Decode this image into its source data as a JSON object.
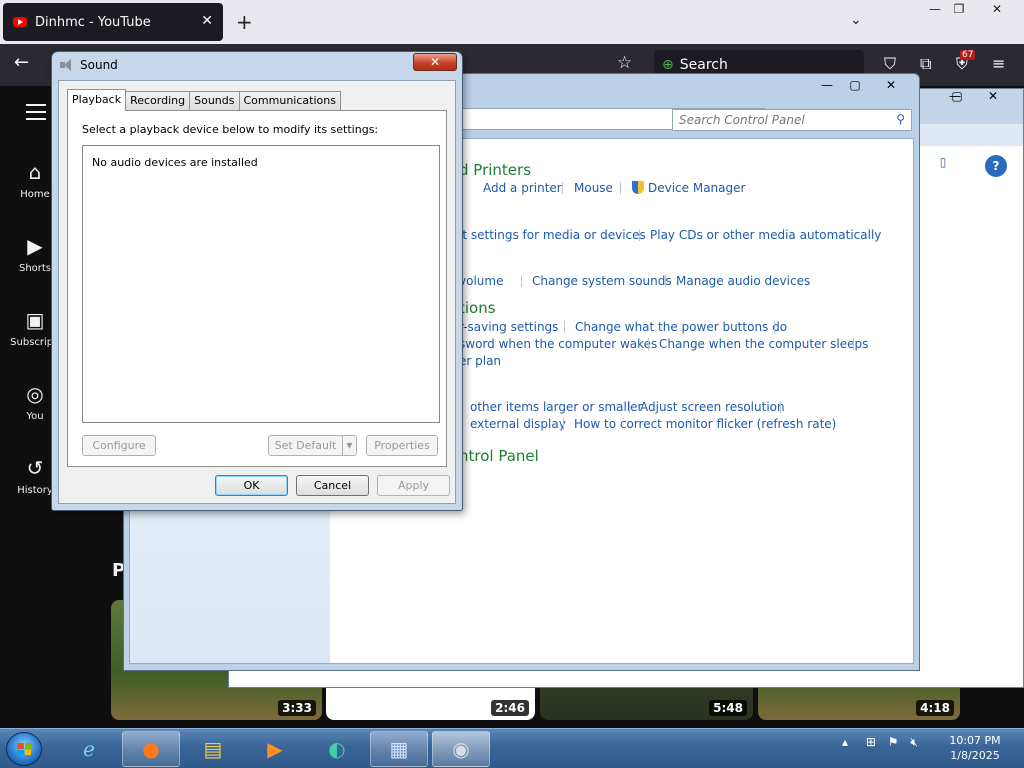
{
  "browser": {
    "tab_title": "Dinhmc - YouTube",
    "new_tab": "+",
    "search_placeholder": "Search",
    "badge": "67"
  },
  "youtube": {
    "nav": [
      {
        "icon": "home-icon",
        "label": "Home"
      },
      {
        "icon": "shorts-icon",
        "label": "Shorts"
      },
      {
        "icon": "subscriptions-icon",
        "label": "Subscripti"
      },
      {
        "icon": "you-icon",
        "label": "You"
      },
      {
        "icon": "history-icon",
        "label": "History"
      }
    ],
    "section_partial": "P",
    "video_durations": [
      "3:33",
      "2:46",
      "5:48",
      "4:18"
    ]
  },
  "control_panel": {
    "search_placeholder": "Search Control Panel",
    "sections": [
      {
        "heading": "d Printers",
        "links": [
          "Add a printer",
          "Mouse",
          "Device Manager"
        ]
      },
      {
        "heading": "",
        "links": [
          "lt settings for media or devices",
          "Play CDs or other media automatically"
        ]
      },
      {
        "heading": "",
        "links": [
          "volume",
          "Change system sounds",
          "Manage audio devices"
        ]
      },
      {
        "heading": "tions",
        "links": [
          "r-saving settings",
          "Change what the power buttons do",
          "sword when the computer wakes",
          "Change when the computer sleeps",
          "er plan"
        ]
      },
      {
        "heading": "",
        "links": [
          "other items larger or smaller",
          "Adjust screen resolution",
          "external display",
          "How to correct monitor flicker (refresh rate)"
        ]
      },
      {
        "heading": "ntrol Panel",
        "links": []
      }
    ]
  },
  "sound_dialog": {
    "title": "Sound",
    "tabs": [
      "Playback",
      "Recording",
      "Sounds",
      "Communications"
    ],
    "active_tab": "Playback",
    "instruction": "Select a playback device below to modify its settings:",
    "empty_message": "No audio devices are installed",
    "configure": "Configure",
    "set_default": "Set Default",
    "properties": "Properties",
    "ok": "OK",
    "cancel": "Cancel",
    "apply": "Apply"
  },
  "taskbar": {
    "time": "10:07 PM",
    "date": "1/8/2025",
    "apps": [
      "ie-icon",
      "firefox-icon",
      "explorer-icon",
      "media-player-icon",
      "app-icon",
      "control-panel-icon",
      "sound-icon"
    ]
  }
}
